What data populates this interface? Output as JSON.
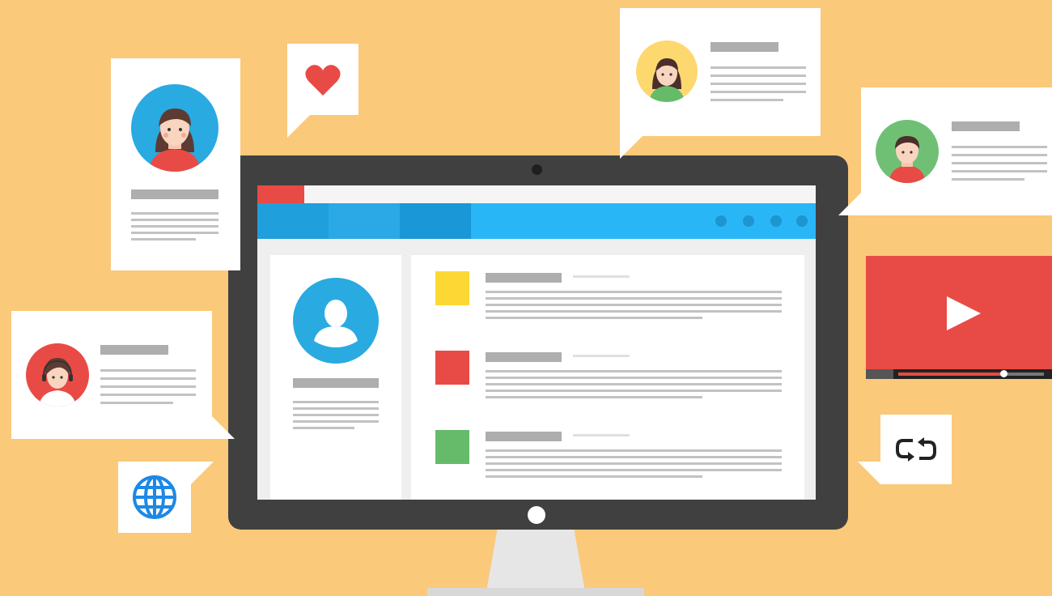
{
  "palette": {
    "background": "#fbc97a",
    "monitor_frame": "#404040",
    "browser_blue": "#29b6f6",
    "accent_red": "#e84b45",
    "accent_yellow": "#fdd835",
    "accent_green": "#66bb6a",
    "avatar_blue": "#29aae1",
    "avatar_yellow": "#fdd86e",
    "avatar_green": "#6fc075"
  },
  "icons": {
    "heart": "heart-icon",
    "globe": "globe-icon",
    "play": "play-icon",
    "repeat": "repeat-icon",
    "profile": "user-silhouette-icon"
  },
  "video": {
    "progress": 0.72
  },
  "feed_posts": [
    {
      "color": "accent_yellow"
    },
    {
      "color": "accent_red"
    },
    {
      "color": "accent_green"
    }
  ]
}
